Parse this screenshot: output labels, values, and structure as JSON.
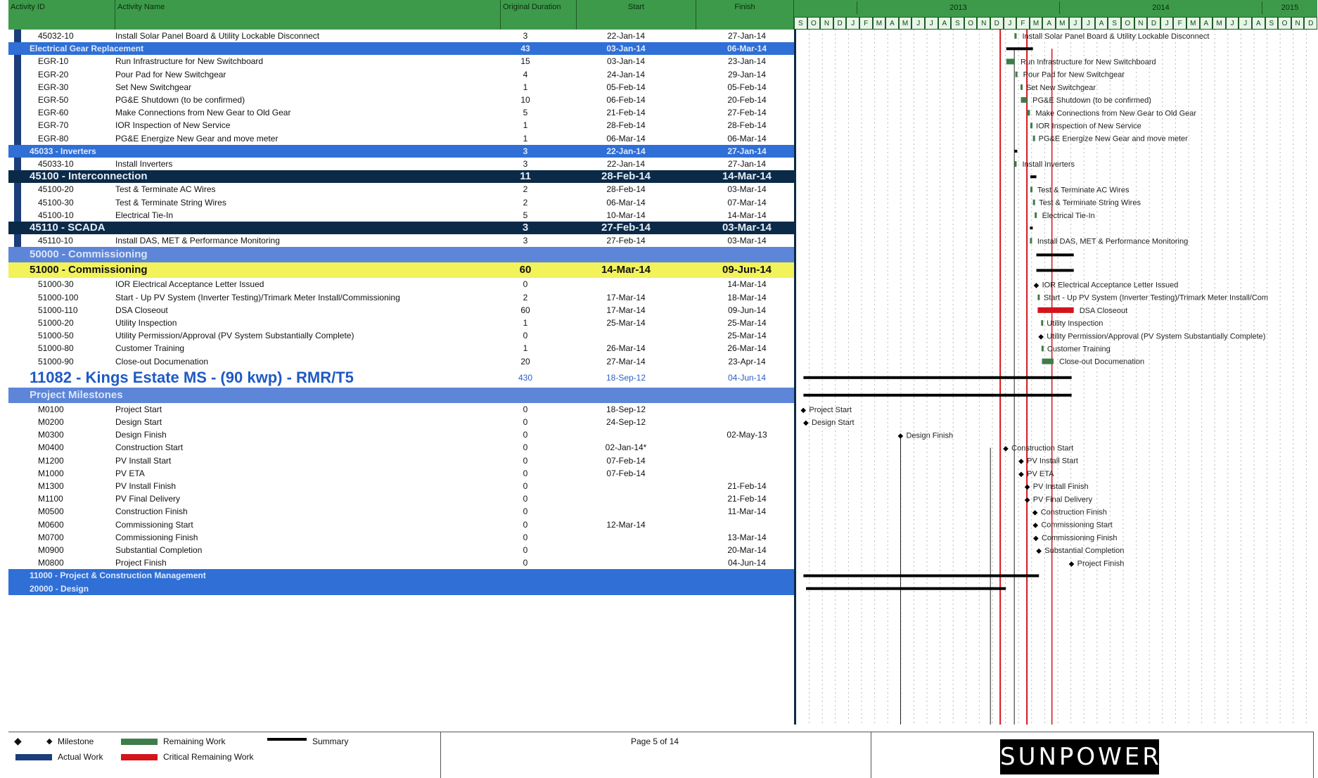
{
  "columns": {
    "activity_id": "Activity ID",
    "activity_name": "Activity Name",
    "original_duration": "Original Duration",
    "start": "Start",
    "finish": "Finish"
  },
  "timeline": {
    "years": [
      "2013",
      "2014",
      "2015"
    ],
    "months": [
      "S",
      "O",
      "N",
      "D",
      "J",
      "F",
      "M",
      "A",
      "M",
      "J",
      "J",
      "A",
      "S",
      "O",
      "N",
      "D",
      "J",
      "F",
      "M",
      "A",
      "M",
      "J",
      "J",
      "A",
      "S",
      "O",
      "N",
      "D",
      "J",
      "F",
      "M",
      "A",
      "M",
      "J",
      "J",
      "A",
      "S",
      "O",
      "N",
      "D"
    ]
  },
  "rows": [
    {
      "id": "45032-10",
      "name": "Install Solar Panel Board & Utility Lockable Disconnect",
      "dur": "3",
      "start": "22-Jan-14",
      "finish": "27-Jan-14",
      "style": "normal"
    },
    {
      "id": "",
      "name": "Electrical Gear Replacement",
      "dur": "43",
      "start": "03-Jan-14",
      "finish": "06-Mar-14",
      "style": "blue"
    },
    {
      "id": "EGR-10",
      "name": "Run Infrastructure for New Switchboard",
      "dur": "15",
      "start": "03-Jan-14",
      "finish": "23-Jan-14",
      "style": "normal"
    },
    {
      "id": "EGR-20",
      "name": "Pour Pad for New Switchgear",
      "dur": "4",
      "start": "24-Jan-14",
      "finish": "29-Jan-14",
      "style": "normal"
    },
    {
      "id": "EGR-30",
      "name": "Set New Switchgear",
      "dur": "1",
      "start": "05-Feb-14",
      "finish": "05-Feb-14",
      "style": "normal"
    },
    {
      "id": "EGR-50",
      "name": "PG&E Shutdown (to be confirmed)",
      "dur": "10",
      "start": "06-Feb-14",
      "finish": "20-Feb-14",
      "style": "normal"
    },
    {
      "id": "EGR-60",
      "name": "Make Connections from New Gear to Old Gear",
      "dur": "5",
      "start": "21-Feb-14",
      "finish": "27-Feb-14",
      "style": "normal"
    },
    {
      "id": "EGR-70",
      "name": "IOR Inspection of New Service",
      "dur": "1",
      "start": "28-Feb-14",
      "finish": "28-Feb-14",
      "style": "normal"
    },
    {
      "id": "EGR-80",
      "name": "PG&E Energize New Gear and move meter",
      "dur": "1",
      "start": "06-Mar-14",
      "finish": "06-Mar-14",
      "style": "normal"
    },
    {
      "id": "",
      "name": "45033 - Inverters",
      "dur": "3",
      "start": "22-Jan-14",
      "finish": "27-Jan-14",
      "style": "blue"
    },
    {
      "id": "45033-10",
      "name": "Install Inverters",
      "dur": "3",
      "start": "22-Jan-14",
      "finish": "27-Jan-14",
      "style": "normal"
    },
    {
      "id": "",
      "name": "45100 - Interconnection",
      "dur": "11",
      "start": "28-Feb-14",
      "finish": "14-Mar-14",
      "style": "navy"
    },
    {
      "id": "45100-20",
      "name": "Test & Terminate AC Wires",
      "dur": "2",
      "start": "28-Feb-14",
      "finish": "03-Mar-14",
      "style": "normal"
    },
    {
      "id": "45100-30",
      "name": "Test & Terminate String Wires",
      "dur": "2",
      "start": "06-Mar-14",
      "finish": "07-Mar-14",
      "style": "normal"
    },
    {
      "id": "45100-10",
      "name": "Electrical Tie-In",
      "dur": "5",
      "start": "10-Mar-14",
      "finish": "14-Mar-14",
      "style": "normal"
    },
    {
      "id": "",
      "name": "45110 - SCADA",
      "dur": "3",
      "start": "27-Feb-14",
      "finish": "03-Mar-14",
      "style": "navy"
    },
    {
      "id": "45110-10",
      "name": "Install DAS, MET & Performance Monitoring",
      "dur": "3",
      "start": "27-Feb-14",
      "finish": "03-Mar-14",
      "style": "normal"
    },
    {
      "id": "",
      "name": "50000 - Commissioning",
      "dur": "",
      "start": "",
      "finish": "",
      "style": "light"
    },
    {
      "id": "",
      "name": "51000 - Commissioning",
      "dur": "60",
      "start": "14-Mar-14",
      "finish": "09-Jun-14",
      "style": "yellow"
    },
    {
      "id": "51000-30",
      "name": "IOR Electrical Acceptance Letter Issued",
      "dur": "0",
      "start": "",
      "finish": "14-Mar-14",
      "style": "normal"
    },
    {
      "id": "51000-100",
      "name": "Start - Up PV System (Inverter Testing)/Trimark Meter Install/Commissioning",
      "dur": "2",
      "start": "17-Mar-14",
      "finish": "18-Mar-14",
      "style": "normal"
    },
    {
      "id": "51000-110",
      "name": "DSA Closeout",
      "dur": "60",
      "start": "17-Mar-14",
      "finish": "09-Jun-14",
      "style": "normal"
    },
    {
      "id": "51000-20",
      "name": "Utility Inspection",
      "dur": "1",
      "start": "25-Mar-14",
      "finish": "25-Mar-14",
      "style": "normal"
    },
    {
      "id": "51000-50",
      "name": "Utility Permission/Approval (PV System Substantially Complete)",
      "dur": "0",
      "start": "",
      "finish": "25-Mar-14",
      "style": "normal"
    },
    {
      "id": "51000-80",
      "name": "Customer Training",
      "dur": "1",
      "start": "26-Mar-14",
      "finish": "26-Mar-14",
      "style": "normal"
    },
    {
      "id": "51000-90",
      "name": "Close-out Documenation",
      "dur": "20",
      "start": "27-Mar-14",
      "finish": "23-Apr-14",
      "style": "normal"
    },
    {
      "id": "",
      "name": "11082 - Kings Estate MS - (90 kwp) - RMR/T5",
      "dur": "430",
      "start": "18-Sep-12",
      "finish": "04-Jun-14",
      "style": "title"
    },
    {
      "id": "",
      "name": "Project Milestones",
      "dur": "",
      "start": "",
      "finish": "",
      "style": "light"
    },
    {
      "id": "M0100",
      "name": "Project Start",
      "dur": "0",
      "start": "18-Sep-12",
      "finish": "",
      "style": "normal"
    },
    {
      "id": "M0200",
      "name": "Design Start",
      "dur": "0",
      "start": "24-Sep-12",
      "finish": "",
      "style": "normal"
    },
    {
      "id": "M0300",
      "name": "Design Finish",
      "dur": "0",
      "start": "",
      "finish": "02-May-13",
      "style": "normal"
    },
    {
      "id": "M0400",
      "name": "Construction Start",
      "dur": "0",
      "start": "02-Jan-14*",
      "finish": "",
      "style": "normal"
    },
    {
      "id": "M1200",
      "name": "PV Install Start",
      "dur": "0",
      "start": "07-Feb-14",
      "finish": "",
      "style": "normal"
    },
    {
      "id": "M1000",
      "name": "PV ETA",
      "dur": "0",
      "start": "07-Feb-14",
      "finish": "",
      "style": "normal"
    },
    {
      "id": "M1300",
      "name": "PV Install Finish",
      "dur": "0",
      "start": "",
      "finish": "21-Feb-14",
      "style": "normal"
    },
    {
      "id": "M1100",
      "name": "PV Final Delivery",
      "dur": "0",
      "start": "",
      "finish": "21-Feb-14",
      "style": "normal"
    },
    {
      "id": "M0500",
      "name": "Construction Finish",
      "dur": "0",
      "start": "",
      "finish": "11-Mar-14",
      "style": "normal"
    },
    {
      "id": "M0600",
      "name": "Commissioning Start",
      "dur": "0",
      "start": "12-Mar-14",
      "finish": "",
      "style": "normal"
    },
    {
      "id": "M0700",
      "name": "Commissioning Finish",
      "dur": "0",
      "start": "",
      "finish": "13-Mar-14",
      "style": "normal"
    },
    {
      "id": "M0900",
      "name": "Substantial Completion",
      "dur": "0",
      "start": "",
      "finish": "20-Mar-14",
      "style": "normal"
    },
    {
      "id": "M0800",
      "name": "Project Finish",
      "dur": "0",
      "start": "",
      "finish": "04-Jun-14",
      "style": "normal"
    },
    {
      "id": "",
      "name": "11000 - Project & Construction Management",
      "dur": "",
      "start": "",
      "finish": "",
      "style": "blue"
    },
    {
      "id": "",
      "name": "20000 - Design",
      "dur": "",
      "start": "",
      "finish": "",
      "style": "blue"
    }
  ],
  "gantt_labels": [
    "Install Solar Panel Board & Utility Lockable Disconnect",
    "Run Infrastructure for New Switchboard",
    "Pour Pad for New Switchgear",
    "Set New Switchgear",
    "PG&E Shutdown (to be confirmed)",
    "Make Connections from New Gear to Old Gear",
    "IOR Inspection of New Service",
    "PG&E Energize New Gear and move meter",
    "Install Inverters",
    "Test & Terminate AC Wires",
    "Test & Terminate String Wires",
    "Electrical Tie-In",
    "Install DAS, MET & Performance Monitoring",
    "IOR Electrical Acceptance Letter Issued",
    "Start - Up PV System (Inverter Testing)/Trimark Meter Install/Com",
    "DSA Closeout",
    "Utility Inspection",
    "Utility Permission/Approval (PV System Substantially Complete)",
    "Customer Training",
    "Close-out Documenation",
    "Project Start",
    "Design Start",
    "Design Finish",
    "Construction Start",
    "PV Install Start",
    "PV ETA",
    "PV Install Finish",
    "PV Final Delivery",
    "Construction Finish",
    "Commissioning Start",
    "Commissioning Finish",
    "Substantial Completion",
    "Project Finish"
  ],
  "legend": {
    "milestone": "Milestone",
    "remaining_work": "Remaining Work",
    "summary": "Summary",
    "actual_work": "Actual Work",
    "critical_remaining_work": "Critical Remaining Work",
    "colors": {
      "milestone": "#000000",
      "remaining_work": "#3e7d4a",
      "summary": "#000000",
      "actual_work": "#1b3d7a",
      "critical": "#d3141b"
    }
  },
  "footer": {
    "page": "Page 5 of 14",
    "brand": "SUNPOWER"
  }
}
